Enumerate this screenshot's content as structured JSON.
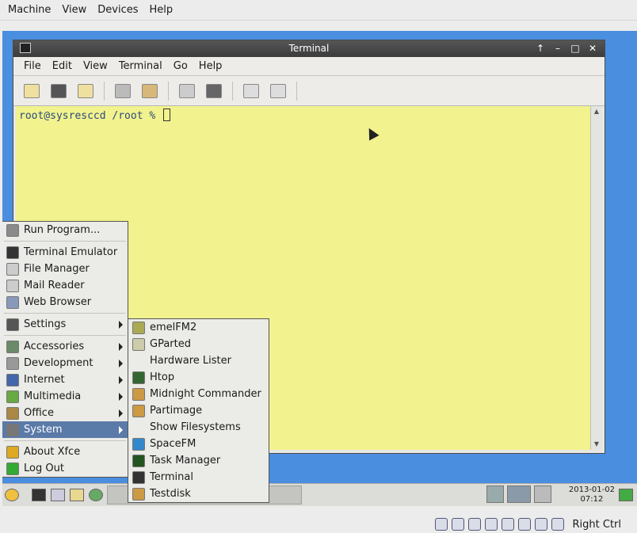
{
  "vbox_menu": [
    "Machine",
    "View",
    "Devices",
    "Help"
  ],
  "terminal": {
    "title": "Terminal",
    "menus": [
      "File",
      "Edit",
      "View",
      "Terminal",
      "Go",
      "Help"
    ],
    "prompt": "root@sysresccd /root % ",
    "controls": [
      "↑",
      "–",
      "□",
      "✕"
    ]
  },
  "main_menu": {
    "items": [
      {
        "label": "Run Program...",
        "icon": "run-icon",
        "color": "#8a8a8a"
      },
      {
        "sep": true
      },
      {
        "label": "Terminal Emulator",
        "icon": "terminal-icon",
        "color": "#333333"
      },
      {
        "label": "File Manager",
        "icon": "file-manager-icon",
        "color": "#cccccc"
      },
      {
        "label": "Mail Reader",
        "icon": "mail-icon",
        "color": "#cccccc"
      },
      {
        "label": "Web Browser",
        "icon": "globe-icon",
        "color": "#8899bb"
      },
      {
        "sep": true
      },
      {
        "label": "Settings",
        "icon": "settings-icon",
        "color": "#555555",
        "sub": true
      },
      {
        "sep": true
      },
      {
        "label": "Accessories",
        "icon": "accessories-icon",
        "color": "#6a8a6a",
        "sub": true
      },
      {
        "label": "Development",
        "icon": "development-icon",
        "color": "#999999",
        "sub": true
      },
      {
        "label": "Internet",
        "icon": "internet-icon",
        "color": "#4466aa",
        "sub": true
      },
      {
        "label": "Multimedia",
        "icon": "multimedia-icon",
        "color": "#66aa44",
        "sub": true
      },
      {
        "label": "Office",
        "icon": "office-icon",
        "color": "#aa8844",
        "sub": true
      },
      {
        "label": "System",
        "icon": "gear-icon",
        "color": "#777777",
        "sub": true,
        "selected": true
      },
      {
        "sep": true
      },
      {
        "label": "About Xfce",
        "icon": "star-icon",
        "color": "#ddaa22"
      },
      {
        "label": "Log Out",
        "icon": "logout-icon",
        "color": "#33aa33"
      }
    ]
  },
  "system_menu": {
    "items": [
      {
        "label": "emelFM2",
        "icon": "emelfm2-icon",
        "color": "#aaaa55"
      },
      {
        "label": "GParted",
        "icon": "gparted-icon",
        "color": "#ccccaa"
      },
      {
        "label": "Hardware Lister",
        "icon": "none",
        "color": "transparent"
      },
      {
        "label": "Htop",
        "icon": "htop-icon",
        "color": "#336633"
      },
      {
        "label": "Midnight Commander",
        "icon": "mc-icon",
        "color": "#cc9944"
      },
      {
        "label": "Partimage",
        "icon": "partimage-icon",
        "color": "#cc9944"
      },
      {
        "label": "Show Filesystems",
        "icon": "none",
        "color": "transparent"
      },
      {
        "label": "SpaceFM",
        "icon": "spacefm-icon",
        "color": "#3388cc"
      },
      {
        "label": "Task Manager",
        "icon": "task-manager-icon",
        "color": "#225522"
      },
      {
        "label": "Terminal",
        "icon": "terminal-icon",
        "color": "#333333"
      },
      {
        "label": "Testdisk",
        "icon": "testdisk-icon",
        "color": "#cc9944"
      }
    ]
  },
  "clock": {
    "date": "2013-01-02",
    "time": "07:12"
  },
  "host_key": "Right Ctrl"
}
